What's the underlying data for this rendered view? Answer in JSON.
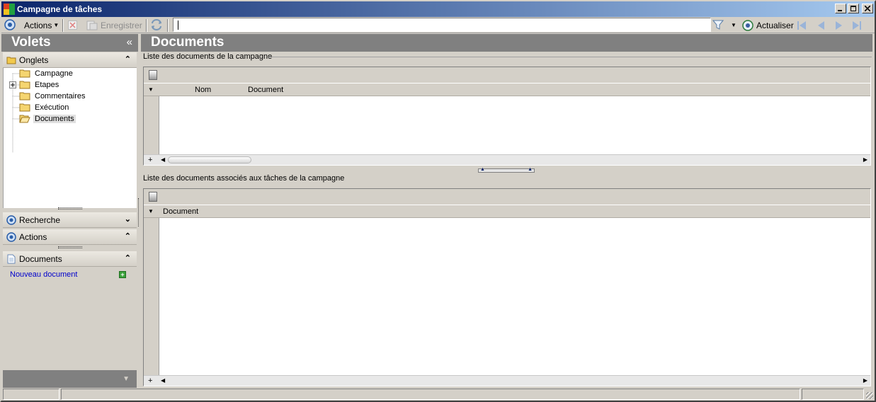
{
  "window": {
    "title": "Campagne de tâches",
    "controls": [
      "minimize",
      "maximize",
      "close"
    ]
  },
  "toolbar": {
    "actions_label": "Actions",
    "save_label": "Enregistrer",
    "search_value": "",
    "refresh_label": "Actualiser"
  },
  "left_panel": {
    "title": "Volets",
    "collapse_glyph": "«",
    "tabs_group": {
      "label": "Onglets",
      "items": [
        {
          "label": "Campagne",
          "expandable": false,
          "selected": false
        },
        {
          "label": "Etapes",
          "expandable": true,
          "selected": false
        },
        {
          "label": "Commentaires",
          "expandable": false,
          "selected": false
        },
        {
          "label": "Exécution",
          "expandable": false,
          "selected": false
        },
        {
          "label": "Documents",
          "expandable": false,
          "selected": true
        }
      ]
    },
    "search_group": {
      "label": "Recherche"
    },
    "actions_group": {
      "label": "Actions"
    },
    "documents_group": {
      "label": "Documents",
      "new_link": "Nouveau document"
    }
  },
  "main": {
    "title": "Documents",
    "campaign_docs": {
      "label": "Liste des documents de la campagne",
      "columns": [
        "Nom",
        "Document"
      ],
      "rows": []
    },
    "task_docs": {
      "label": "Liste des documents associés aux tâches de la campagne",
      "columns": [
        "Document"
      ],
      "rows": []
    }
  },
  "colors": {
    "titlebar_start": "#0a246a",
    "titlebar_end": "#a6caf0",
    "panel_header": "#808080",
    "link": "#0000cc"
  }
}
